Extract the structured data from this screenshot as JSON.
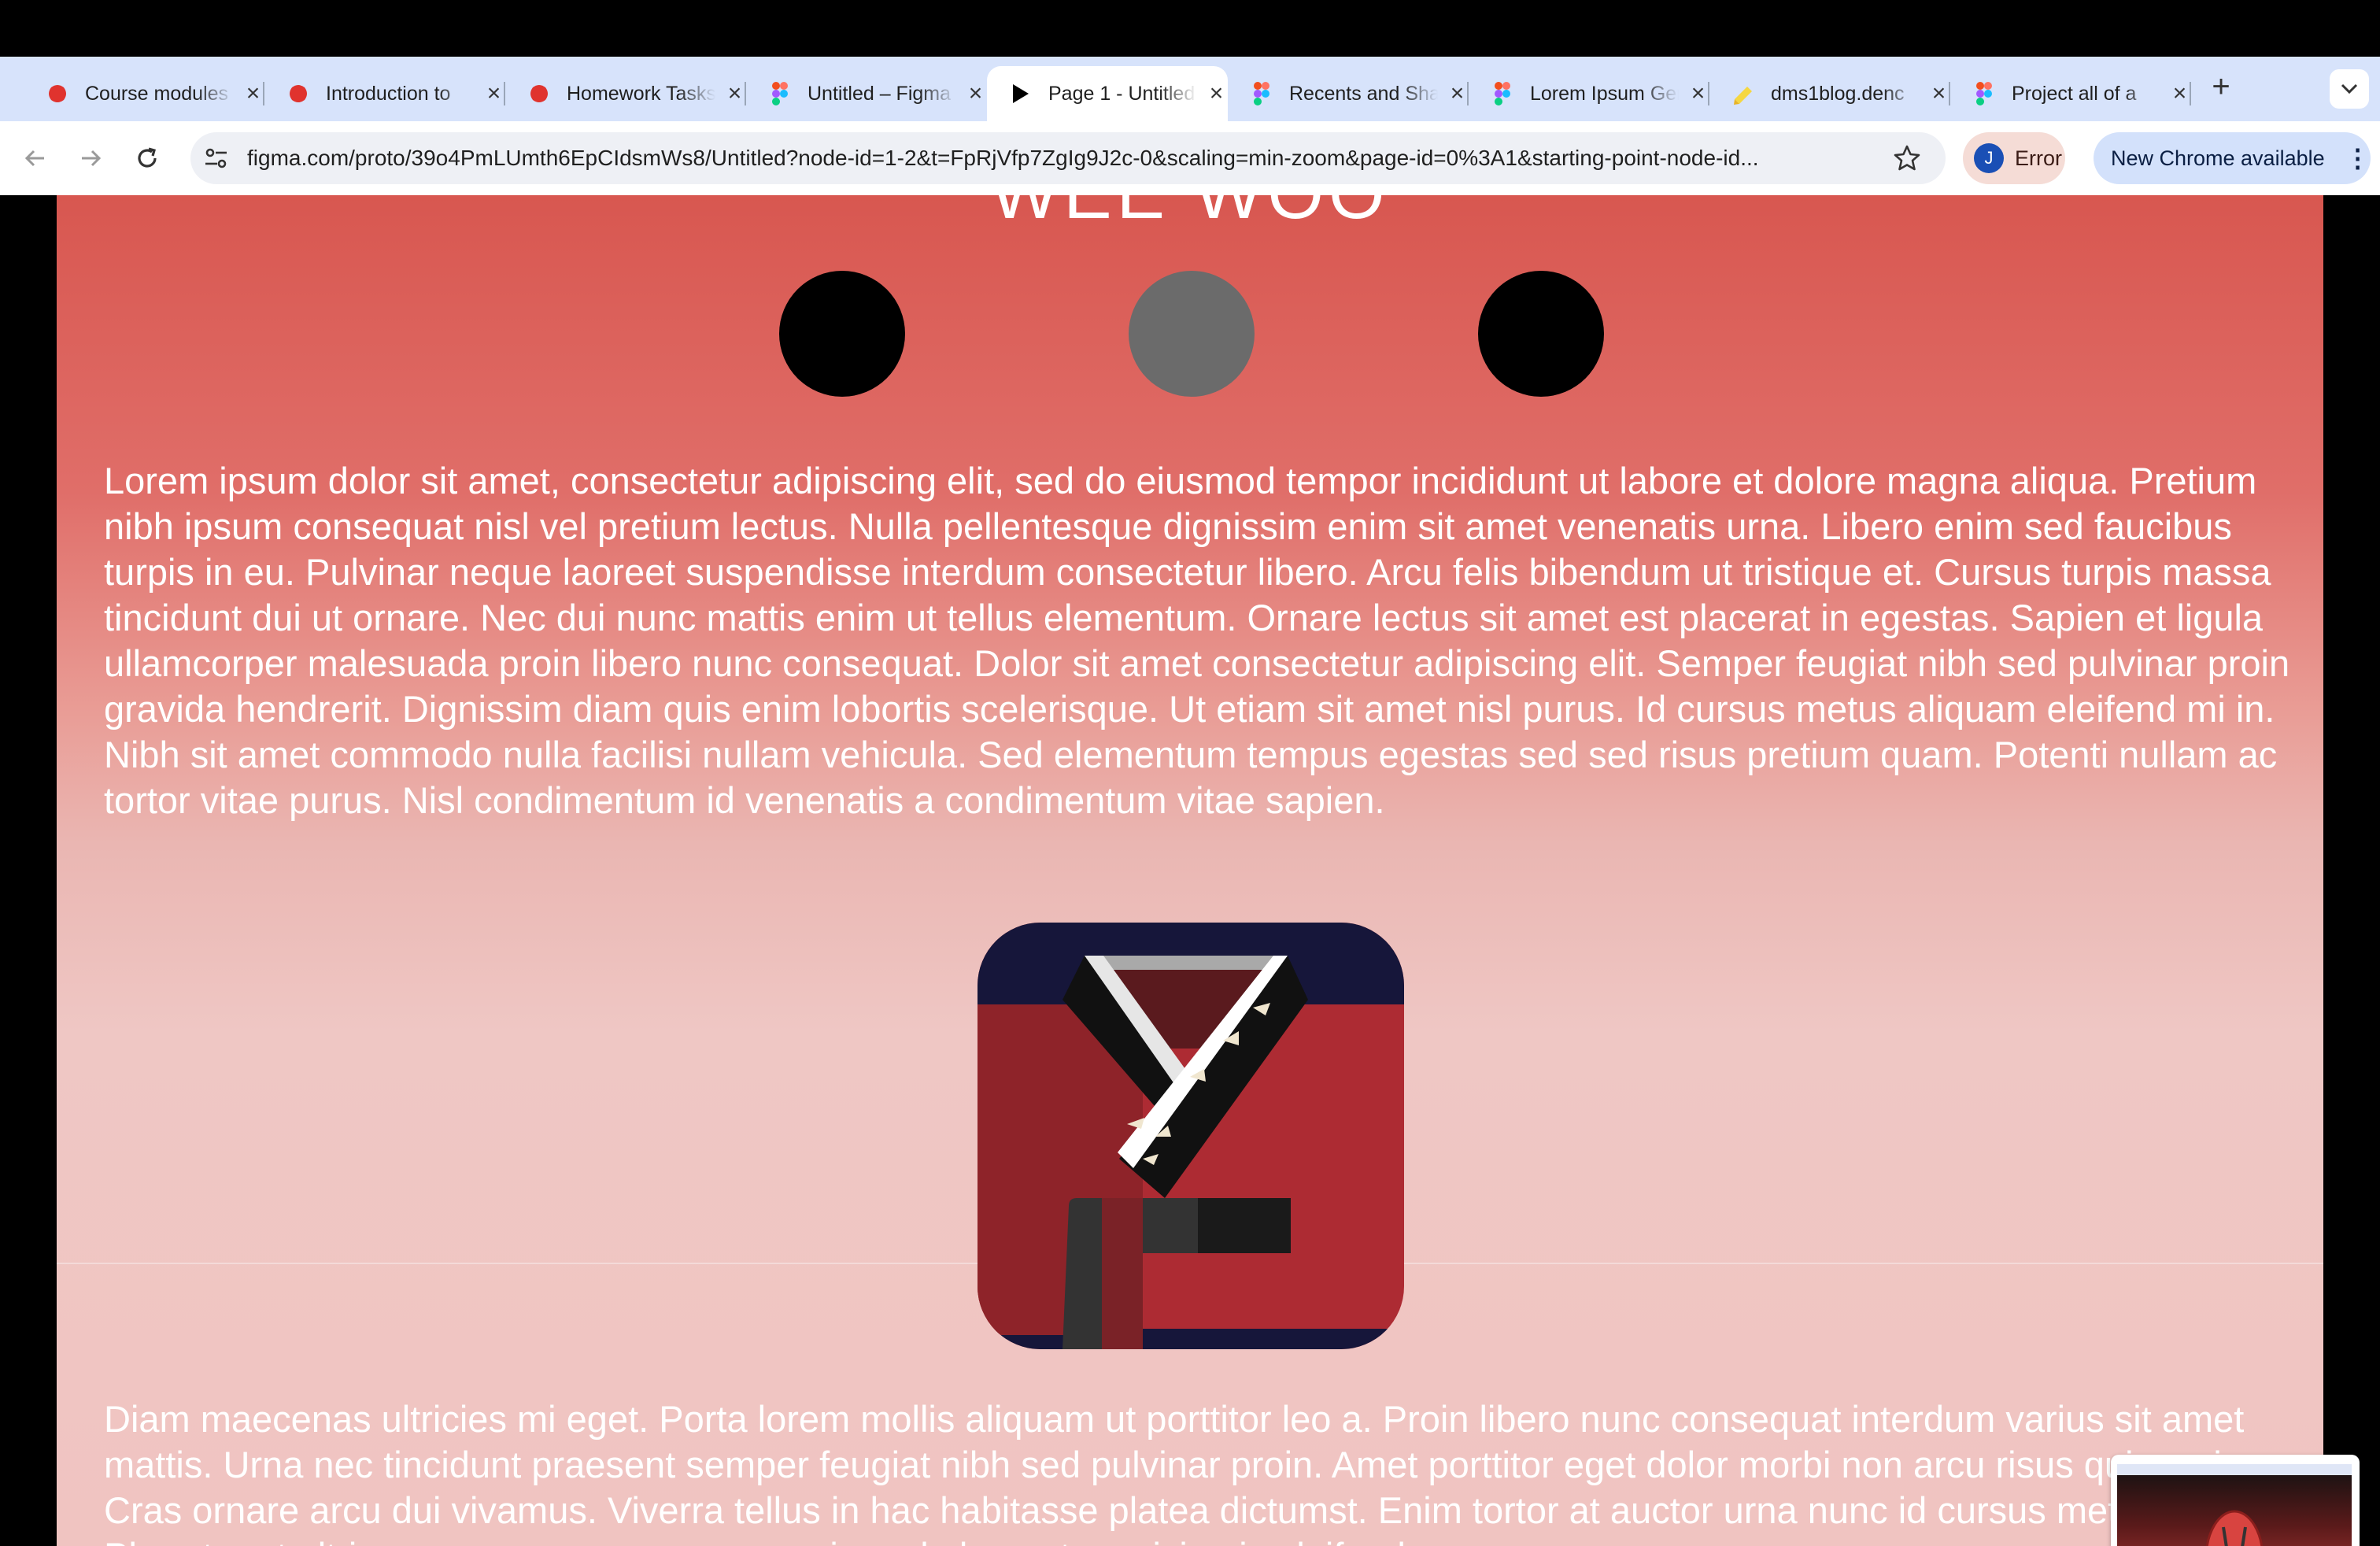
{
  "browser": {
    "tabs": [
      {
        "title": "Course modules",
        "favicon": "red-blob-icon",
        "active": false
      },
      {
        "title": "Introduction to",
        "favicon": "red-blob-icon",
        "active": false
      },
      {
        "title": "Homework Tasks",
        "favicon": "red-blob-icon",
        "active": false
      },
      {
        "title": "Untitled – Figma",
        "favicon": "figma-icon",
        "active": false
      },
      {
        "title": "Page 1 - Untitled",
        "favicon": "play-icon",
        "active": true
      },
      {
        "title": "Recents and Sharing",
        "favicon": "figma-icon",
        "active": false
      },
      {
        "title": "Lorem Ipsum Generator",
        "favicon": "figma-icon",
        "active": false
      },
      {
        "title": "dms1blog.denc",
        "favicon": "pencil-icon",
        "active": false
      },
      {
        "title": "Project all of a",
        "favicon": "figma-icon",
        "active": false
      }
    ],
    "url": "figma.com/proto/39o4PmLUmth6EpCIdsmWs8/Untitled?node-id=1-2&t=FpRjVfp7ZgIg9J2c-0&scaling=min-zoom&page-id=0%3A1&starting-point-node-id...",
    "profile": {
      "initial": "J",
      "label": "Error"
    },
    "update_label": "New Chrome available"
  },
  "page": {
    "heading": "WEE WOO",
    "dots": [
      "#000000",
      "#6b6b6b",
      "#000000"
    ],
    "paragraph1": "Lorem ipsum dolor sit amet, consectetur adipiscing elit, sed do eiusmod tempor incididunt ut labore et dolore magna aliqua. Pretium nibh ipsum consequat nisl vel pretium lectus. Nulla pellentesque dignissim enim sit amet venenatis urna. Libero enim sed faucibus turpis in eu. Pulvinar neque laoreet suspendisse interdum consectetur libero. Arcu felis bibendum ut tristique et. Cursus turpis massa tincidunt dui ut ornare. Nec dui nunc mattis enim ut tellus elementum. Ornare lectus sit amet est placerat in egestas. Sapien et ligula ullamcorper malesuada proin libero nunc consequat. Dolor sit amet consectetur adipiscing elit. Semper feugiat nibh sed pulvinar proin gravida hendrerit. Dignissim diam quis enim lobortis scelerisque. Ut etiam sit amet nisl purus. Id cursus metus aliquam eleifend mi in. Nibh sit amet commodo nulla facilisi nullam vehicula. Sed elementum tempus egestas sed sed risus pretium quam. Potenti nullam ac tortor vitae purus. Nisl condimentum id venenatis a condimentum vitae sapien.",
    "paragraph2": "Diam maecenas ultricies mi eget. Porta lorem mollis aliquam ut porttitor leo a. Proin libero nunc consequat interdum varius sit amet mattis. Urna nec tincidunt praesent semper feugiat nibh sed pulvinar proin. Amet porttitor eget dolor morbi non arcu risus quis varius. Cras ornare arcu dui vivamus. Viverra tellus in hac habitasse platea dictumst. Enim tortor at auctor urna nunc id cursus metus. Pharetra et ultrices neque ornare aenean euismod elementum nisi quis eleifend quam.",
    "image": "robe-icon",
    "colors": {
      "accent": "#d85750",
      "robe_red": "#ad2b33",
      "robe_navy": "#16163a"
    }
  }
}
